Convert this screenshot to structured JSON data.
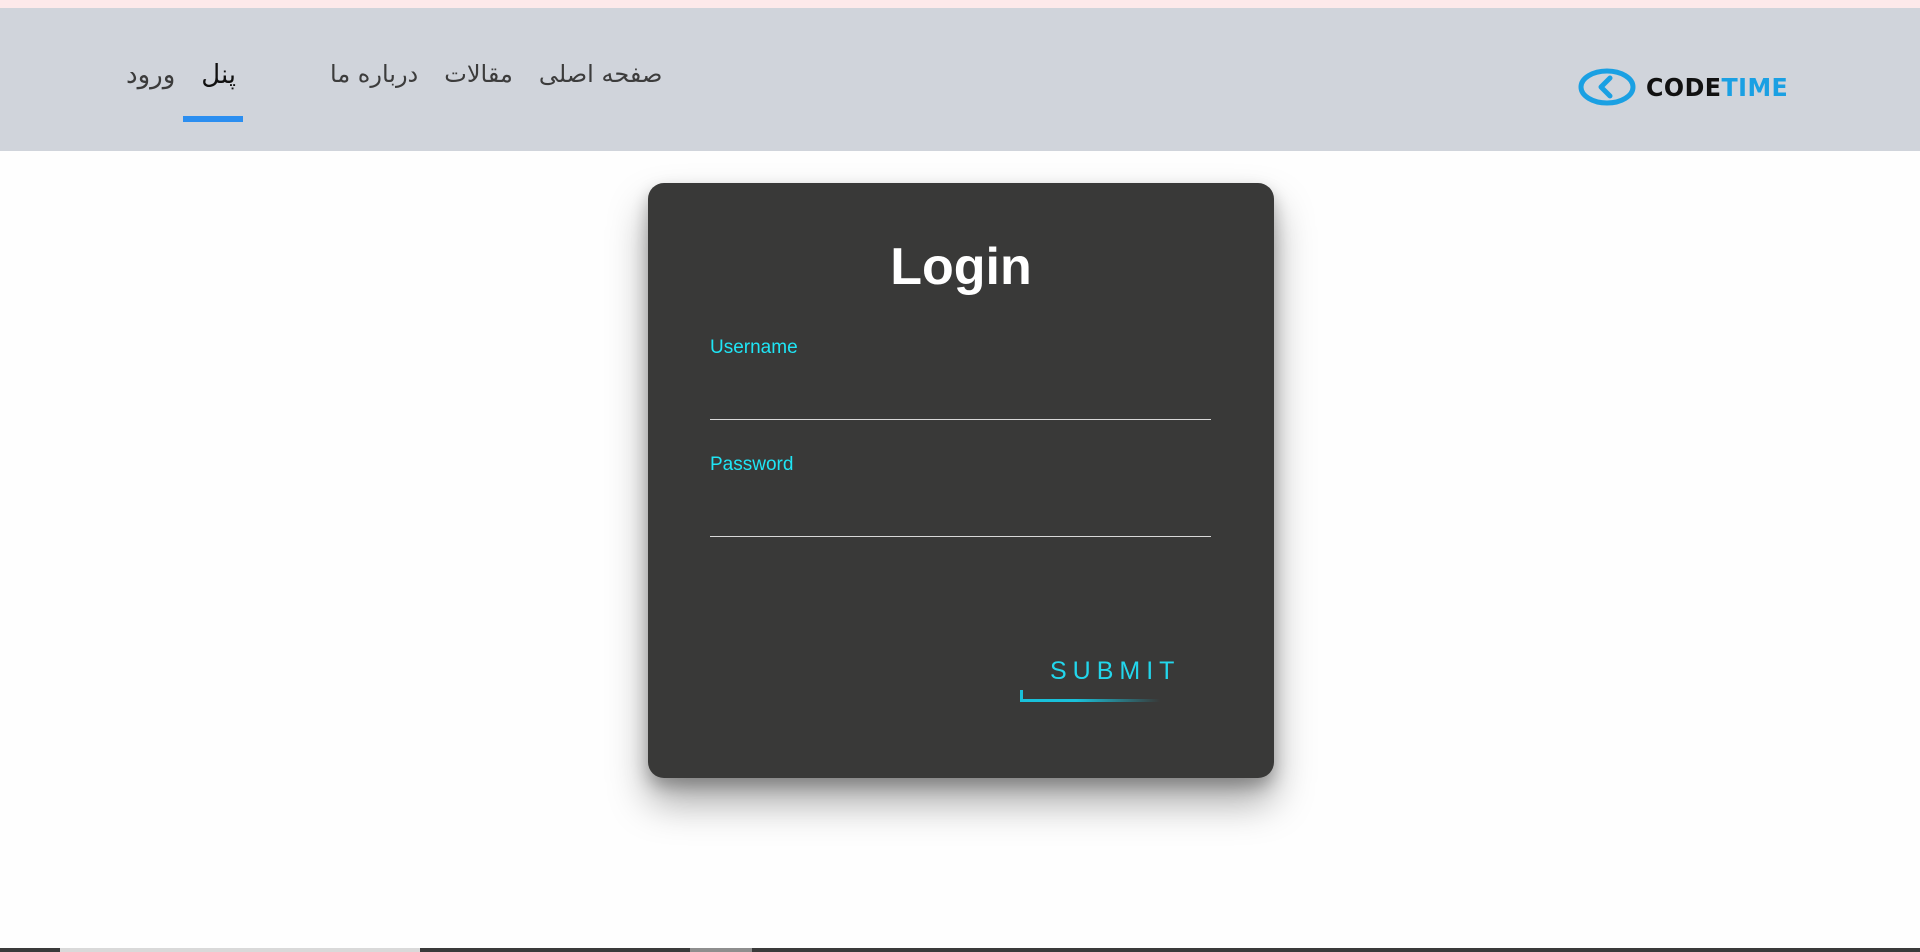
{
  "nav": {
    "links": [
      "صفحه اصلی",
      "مقالات",
      "درباره ما"
    ],
    "auth": {
      "panel": "پنل",
      "login": "ورود",
      "active": "panel"
    }
  },
  "logo": {
    "code": "CODE",
    "time": "TIME",
    "icon": "chevron-left-circle-icon"
  },
  "login_card": {
    "title": "Login",
    "username_label": "Username",
    "username_value": "",
    "password_label": "Password",
    "password_value": "",
    "submit_label": "SUBMIT"
  },
  "colors": {
    "navbar": "#d0d4db",
    "card": "#393938",
    "accent_cyan": "#1fe5f5",
    "active_tab": "#2b8ef0",
    "logo_blue": "#1aa0e3"
  }
}
